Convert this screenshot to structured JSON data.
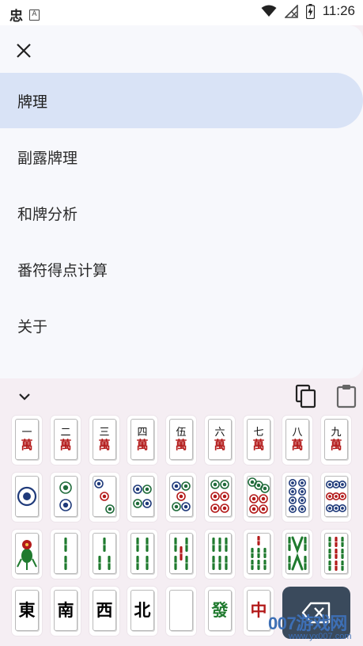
{
  "status_bar": {
    "app_glyph": "忠",
    "notif_glyph": "A",
    "time": "11:26"
  },
  "drawer": {
    "close_icon": "close-icon",
    "menu": [
      {
        "label": "牌理",
        "active": true
      },
      {
        "label": "副露牌理",
        "active": false
      },
      {
        "label": "和牌分析",
        "active": false
      },
      {
        "label": "番符得点计算",
        "active": false
      },
      {
        "label": "关于",
        "active": false
      }
    ]
  },
  "keyboard": {
    "collapse_icon": "chevron-down-icon",
    "copy_icon": "copy-icon",
    "paste_icon": "clipboard-icon",
    "man": [
      {
        "num": "一",
        "suit": "萬"
      },
      {
        "num": "二",
        "suit": "萬"
      },
      {
        "num": "三",
        "suit": "萬"
      },
      {
        "num": "四",
        "suit": "萬"
      },
      {
        "num": "伍",
        "suit": "萬"
      },
      {
        "num": "六",
        "suit": "萬"
      },
      {
        "num": "七",
        "suit": "萬"
      },
      {
        "num": "八",
        "suit": "萬"
      },
      {
        "num": "九",
        "suit": "萬"
      }
    ],
    "pin": [
      1,
      2,
      3,
      4,
      5,
      6,
      7,
      8,
      9
    ],
    "sou": [
      1,
      2,
      3,
      4,
      5,
      6,
      7,
      8,
      9
    ],
    "honors": [
      {
        "text": "東",
        "color": "#111111"
      },
      {
        "text": "南",
        "color": "#111111"
      },
      {
        "text": "西",
        "color": "#111111"
      },
      {
        "text": "北",
        "color": "#111111"
      },
      {
        "text": "",
        "color": "#111111"
      },
      {
        "text": "發",
        "color": "#1f7a2e"
      },
      {
        "text": "中",
        "color": "#b31a1a"
      }
    ],
    "backspace_icon": "backspace-icon"
  },
  "watermark": {
    "big": "007游戏网",
    "small": "www.yx007.com"
  },
  "colors": {
    "drawer_bg": "#f7f8fc",
    "active_item": "#d9e3f6",
    "panel_bg": "#f5eef3",
    "man_red": "#b31a1a",
    "pin_blue": "#1f3a7a",
    "pin_red": "#b31a1a",
    "sou_green": "#1f7a2e",
    "backspace_bg": "#3a4a5c"
  }
}
